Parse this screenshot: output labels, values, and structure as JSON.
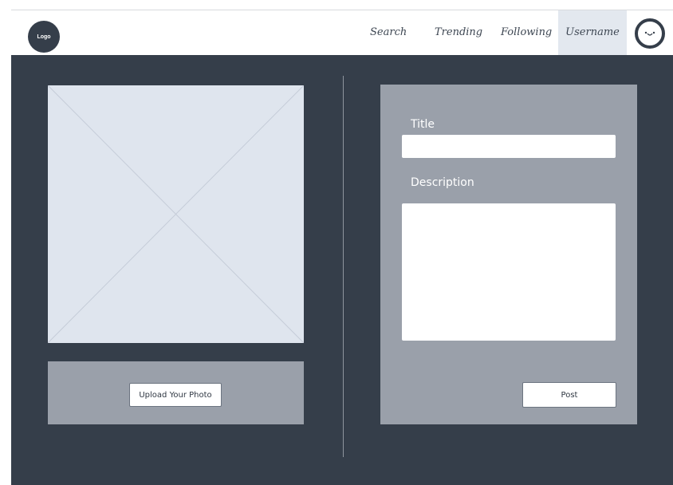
{
  "header": {
    "logo_text": "Logo",
    "nav": {
      "search": "Search",
      "trending": "Trending",
      "following": "Following",
      "username": "Username"
    },
    "avatar_icon": "smiley-face-icon"
  },
  "upload": {
    "image_icon": "image-placeholder-icon",
    "button_label": "Upload Your Photo"
  },
  "form": {
    "title_label": "Title",
    "title_value": "",
    "description_label": "Description",
    "description_value": "",
    "post_label": "Post"
  },
  "colors": {
    "background": "#353e4a",
    "header": "#ffffff",
    "panel": "#9aa0aa",
    "placeholder": "#dfe5ee",
    "active_nav": "#e3e8ef"
  }
}
